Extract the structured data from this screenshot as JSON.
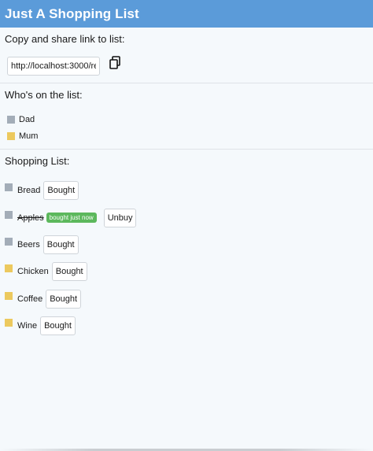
{
  "header": {
    "title": "Just A Shopping List",
    "color": "#5b9bd9"
  },
  "share": {
    "heading": "Copy and share link to list:",
    "link_value": "http://localhost:3000/re",
    "copy_icon": "copy-icon"
  },
  "people": {
    "heading": "Who's on the list:",
    "items": [
      {
        "name": "Dad",
        "color": "#a3adb8"
      },
      {
        "name": "Mum",
        "color": "#ecc95e"
      }
    ]
  },
  "shopping": {
    "heading": "Shopping List:",
    "items": [
      {
        "name": "Bread",
        "color": "#a3adb8",
        "bought": false,
        "button": "Bought"
      },
      {
        "name": "Apples",
        "color": "#a3adb8",
        "bought": true,
        "badge": "bought just now",
        "button": "Unbuy"
      },
      {
        "name": "Beers",
        "color": "#a3adb8",
        "bought": false,
        "button": "Bought"
      },
      {
        "name": "Chicken",
        "color": "#ecc95e",
        "bought": false,
        "button": "Bought"
      },
      {
        "name": "Coffee",
        "color": "#ecc95e",
        "bought": false,
        "button": "Bought"
      },
      {
        "name": "Wine",
        "color": "#ecc95e",
        "bought": false,
        "button": "Bought"
      }
    ],
    "badge_color": "#5cb85c"
  }
}
